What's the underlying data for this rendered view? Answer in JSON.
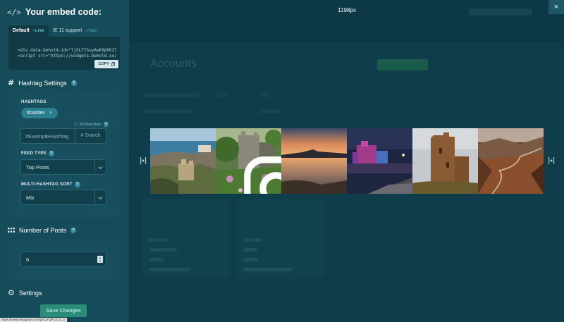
{
  "embed": {
    "title": "Your embed code:",
    "tabs": [
      {
        "label": "Default",
        "size": "~1.8kb"
      },
      {
        "label": "IE 11 support",
        "size": "~7.5kb"
      }
    ],
    "code_lines": [
      "<div data-behold-id=\"lj5LT7SuyAwK9phKZl",
      "<script src=\"https://widgets.behold.so/"
    ],
    "copy_label": "COPY"
  },
  "hashtag_settings": {
    "title": "Hashtag Settings",
    "hashtags_label": "HASHTAGS",
    "chip": "#castles",
    "counter": "1 / 30 Searches",
    "search_placeholder": "#ExampleHashtag",
    "search_button": "# Search",
    "feed_type_label": "FEED TYPE",
    "feed_type_value": "Top Posts",
    "sort_label": "MULTI-HASHTAG SORT",
    "sort_value": "Mix"
  },
  "number_of_posts": {
    "title": "Number of Posts",
    "value": "6"
  },
  "settings": {
    "title": "Settings"
  },
  "save_button": "Save Changes",
  "status_url": "https://www.instagram.com/p/CJYQPLS13_L/",
  "preview": {
    "width_label": "1198px",
    "close_symbol": "×"
  },
  "background": {
    "accounts_title": "Accounts"
  },
  "gallery": [
    {
      "icon": "coastal-castle-photo"
    },
    {
      "icon": "overgrown-castle-photo"
    },
    {
      "icon": "sunset-reflection-photo"
    },
    {
      "icon": "illuminated-castle-night-photo"
    },
    {
      "icon": "ruined-tower-photo"
    },
    {
      "icon": "mountain-valley-road-photo"
    }
  ],
  "colors": {
    "panel_bg": "#164b59",
    "accent": "#2a8d7a",
    "chip": "#2a7e8f",
    "background": "#0f3d4b"
  }
}
